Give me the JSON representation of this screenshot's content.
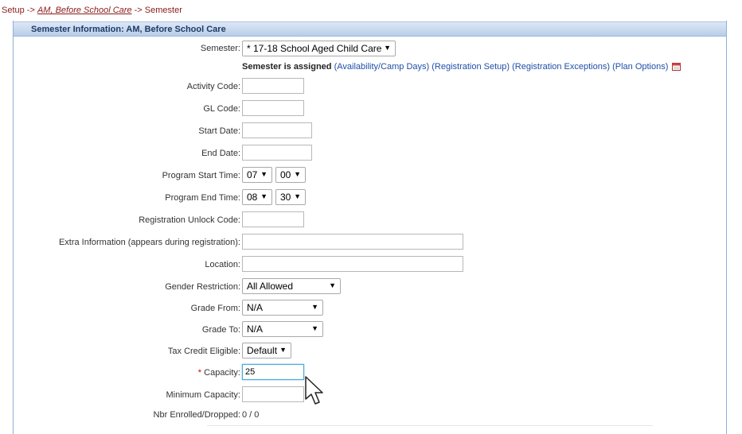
{
  "breadcrumb": {
    "prefix": "Setup ->",
    "link": "AM, Before School Care",
    "suffix": "-> Semester"
  },
  "panel": {
    "title": "Semester Information: AM, Before School Care"
  },
  "form": {
    "semester": {
      "label": "Semester:",
      "value": "* 17-18 School Aged Child Care"
    },
    "assigned": {
      "status": "Semester is assigned",
      "links": [
        "(Availability/Camp Days)",
        "(Registration Setup)",
        "(Registration Exceptions)",
        "(Plan Options)"
      ],
      "icon": "calendar-icon"
    },
    "activity_code": {
      "label": "Activity Code:",
      "value": ""
    },
    "gl_code": {
      "label": "GL Code:",
      "value": ""
    },
    "start_date": {
      "label": "Start Date:",
      "value": ""
    },
    "end_date": {
      "label": "End Date:",
      "value": ""
    },
    "program_start": {
      "label": "Program Start Time:",
      "hour": "07",
      "minute": "00"
    },
    "program_end": {
      "label": "Program End Time:",
      "hour": "08",
      "minute": "30"
    },
    "unlock_code": {
      "label": "Registration Unlock Code:",
      "value": ""
    },
    "extra_info": {
      "label": "Extra Information (appears during registration):",
      "value": ""
    },
    "location": {
      "label": "Location:",
      "value": ""
    },
    "gender": {
      "label": "Gender Restriction:",
      "value": "All Allowed"
    },
    "grade_from": {
      "label": "Grade From:",
      "value": "N/A"
    },
    "grade_to": {
      "label": "Grade To:",
      "value": "N/A"
    },
    "tax_credit": {
      "label": "Tax Credit Eligible:",
      "value": "Default"
    },
    "capacity": {
      "star": "*",
      "label": " Capacity:",
      "value": "25"
    },
    "min_capacity": {
      "label": "Minimum Capacity:",
      "value": ""
    },
    "enrolled": {
      "label": "Nbr Enrolled/Dropped:",
      "value": "0 / 0"
    }
  },
  "colors": {
    "accent_link": "#1f4fa8",
    "breadcrumb": "#8b1a1a",
    "header_text": "#1d3b66",
    "focus_border": "#4ba6d8"
  }
}
